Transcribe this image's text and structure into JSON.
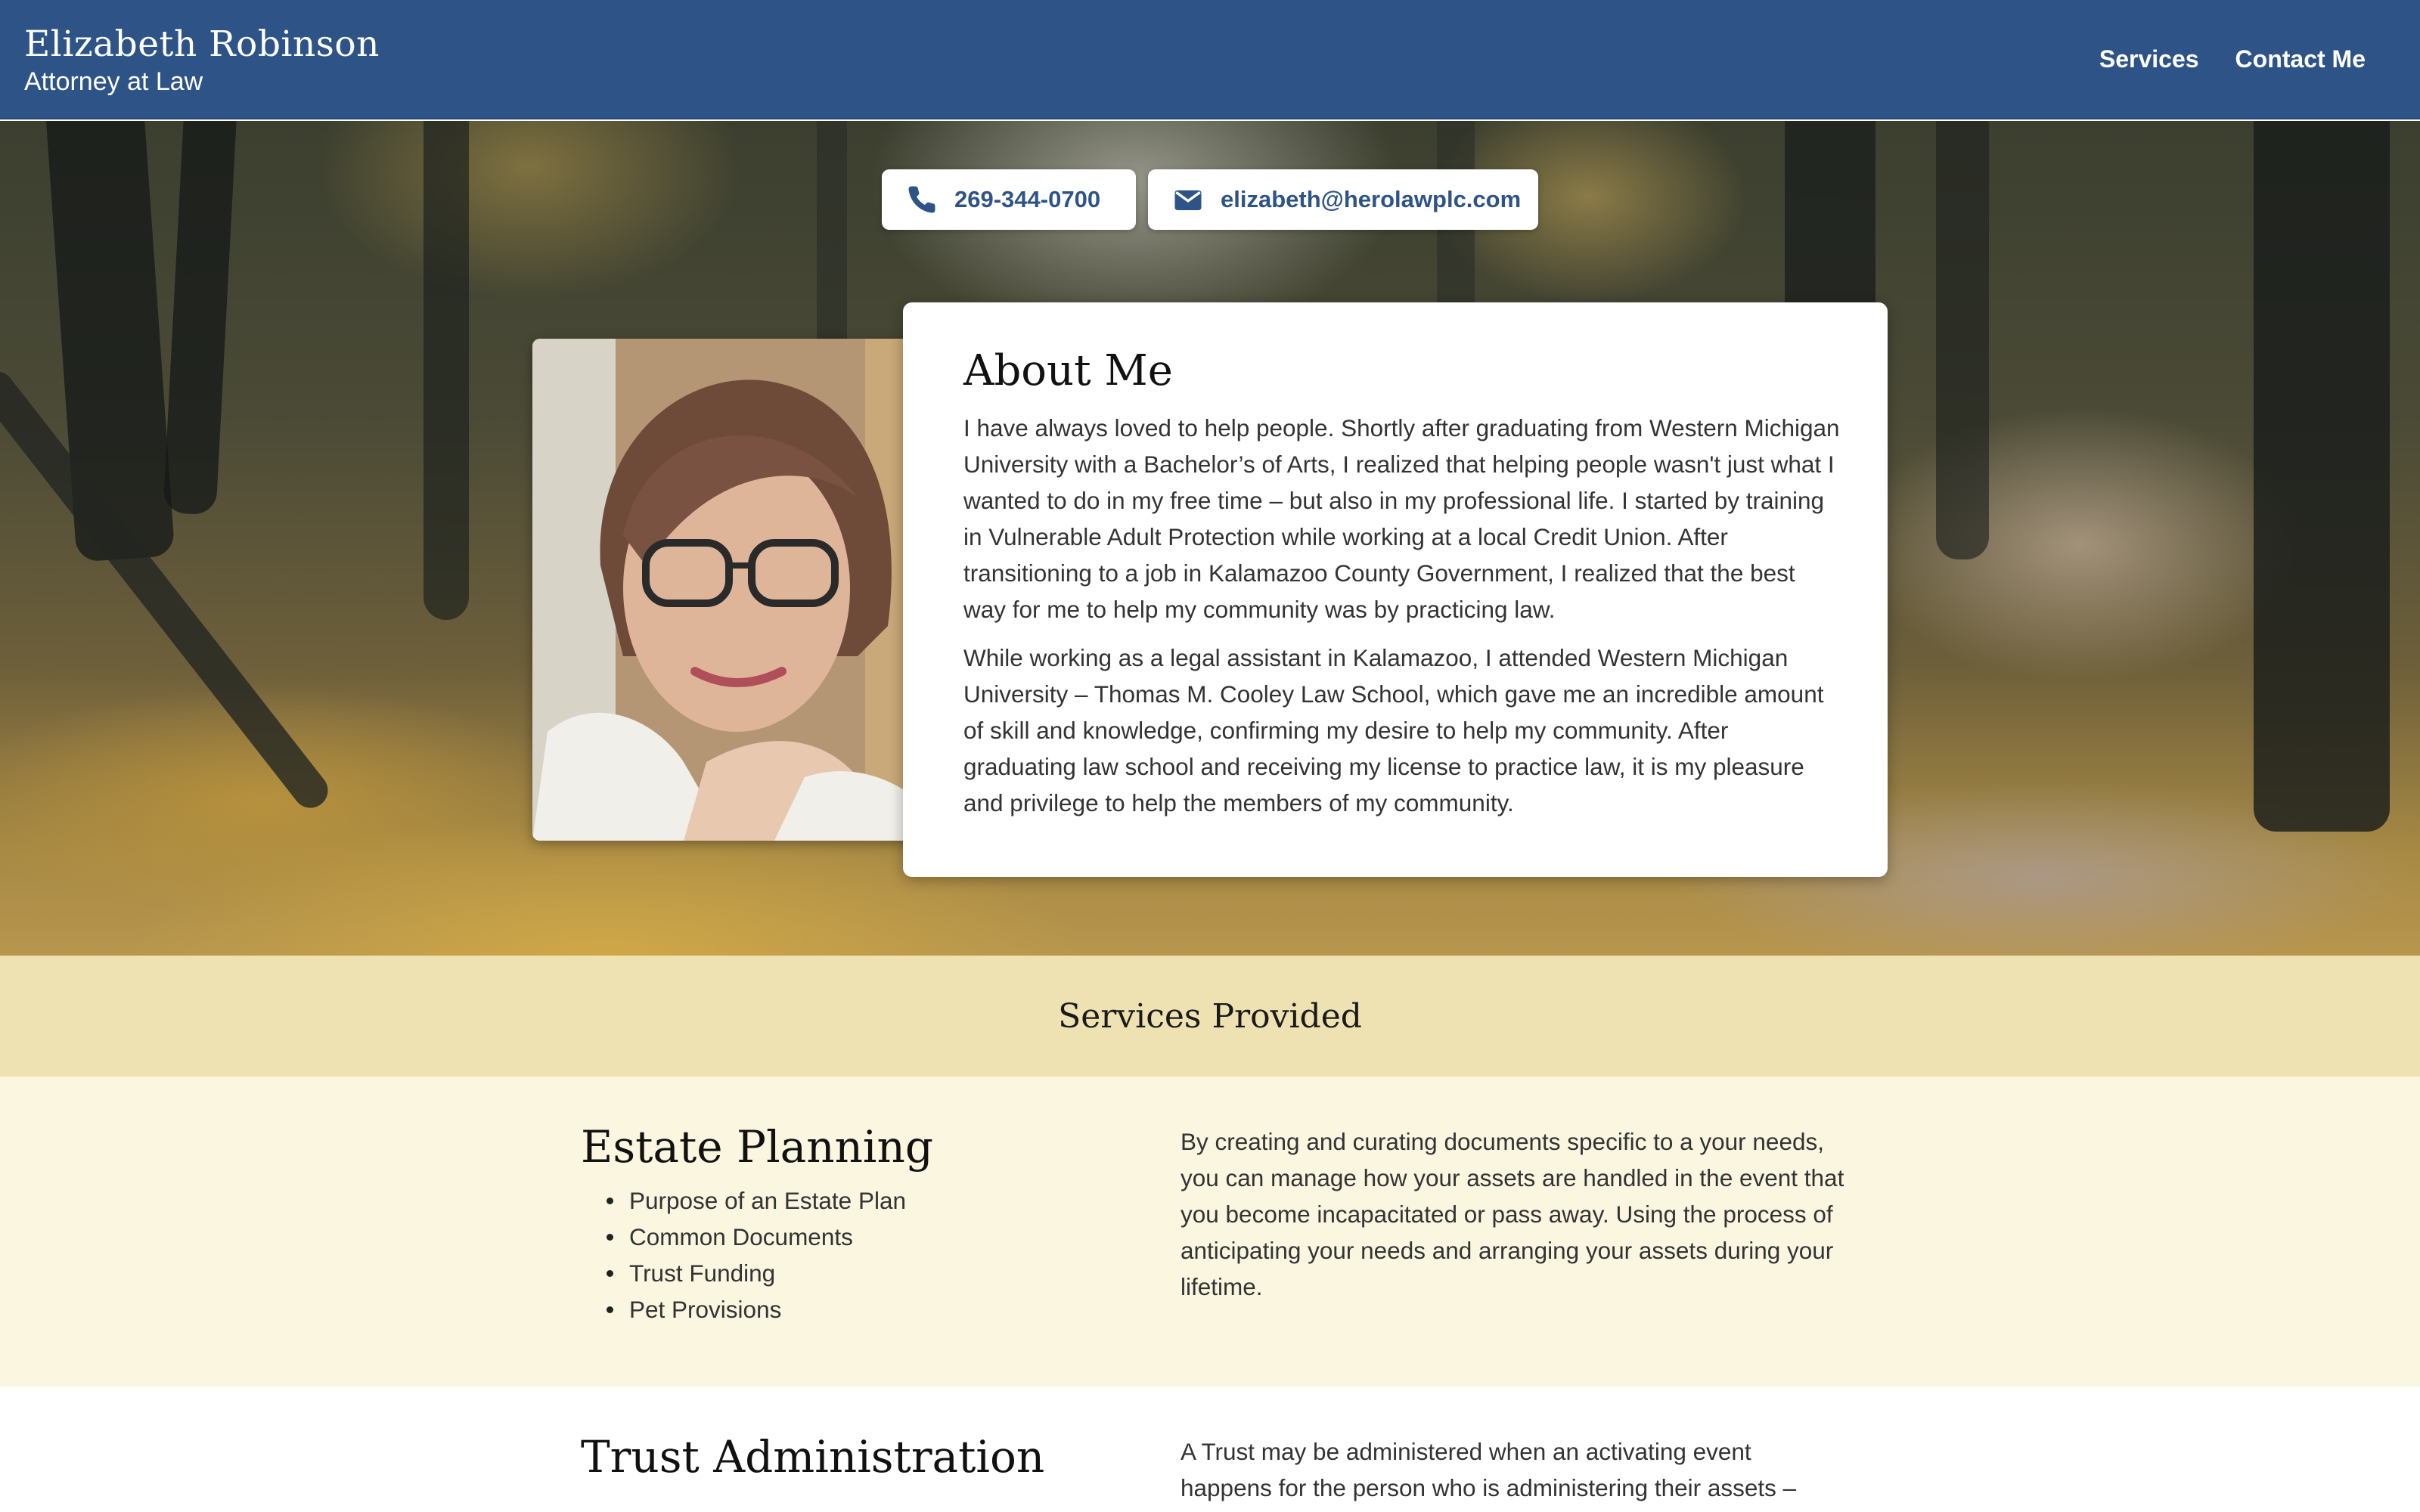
{
  "header": {
    "name": "Elizabeth Robinson",
    "subtitle": "Attorney at Law",
    "nav": [
      {
        "label": "Services"
      },
      {
        "label": "Contact Me"
      }
    ]
  },
  "contacts": {
    "phone": "269-344-0700",
    "email": "elizabeth@herolawplc.com"
  },
  "about": {
    "title": "About Me",
    "paragraphs": [
      "I have always loved to help people. Shortly after graduating from Western Michigan University with a Bachelor’s of Arts, I realized that helping people wasn't just what I wanted to do in my free time – but also in my professional life. I started by training in Vulnerable Adult Protection while working at a local Credit Union. After transitioning to a job in Kalamazoo County Government, I realized that the best way for me to help my community was by practicing law.",
      "While working as a legal assistant in Kalamazoo, I attended Western Michigan University – Thomas M. Cooley Law School, which gave me an incredible amount of skill and knowledge, confirming my desire to help my community. After graduating law school and receiving my license to practice law, it is my pleasure and privilege to help the members of my community."
    ]
  },
  "services": {
    "title": "Services Provided",
    "items": [
      {
        "title": "Estate Planning",
        "bullets": [
          "Purpose of an Estate Plan",
          "Common Documents",
          "Trust Funding",
          "Pet Provisions"
        ],
        "description": "By creating and curating documents specific to a your needs, you can manage how your assets are handled in the event that you become incapacitated or pass away. Using the process of anticipating your needs and arranging your assets during your lifetime."
      },
      {
        "title": "Trust Administration",
        "bullets": [],
        "description": "A Trust may be administered when an activating event happens for the person who is administering their assets –"
      }
    ]
  },
  "colors": {
    "header_bg": "#2e5487",
    "accent_text": "#2e5487",
    "services_band": "#eee2b3",
    "service_bg": "#faf6e0"
  },
  "icons": {
    "phone": "phone-icon",
    "email": "envelope-icon"
  }
}
